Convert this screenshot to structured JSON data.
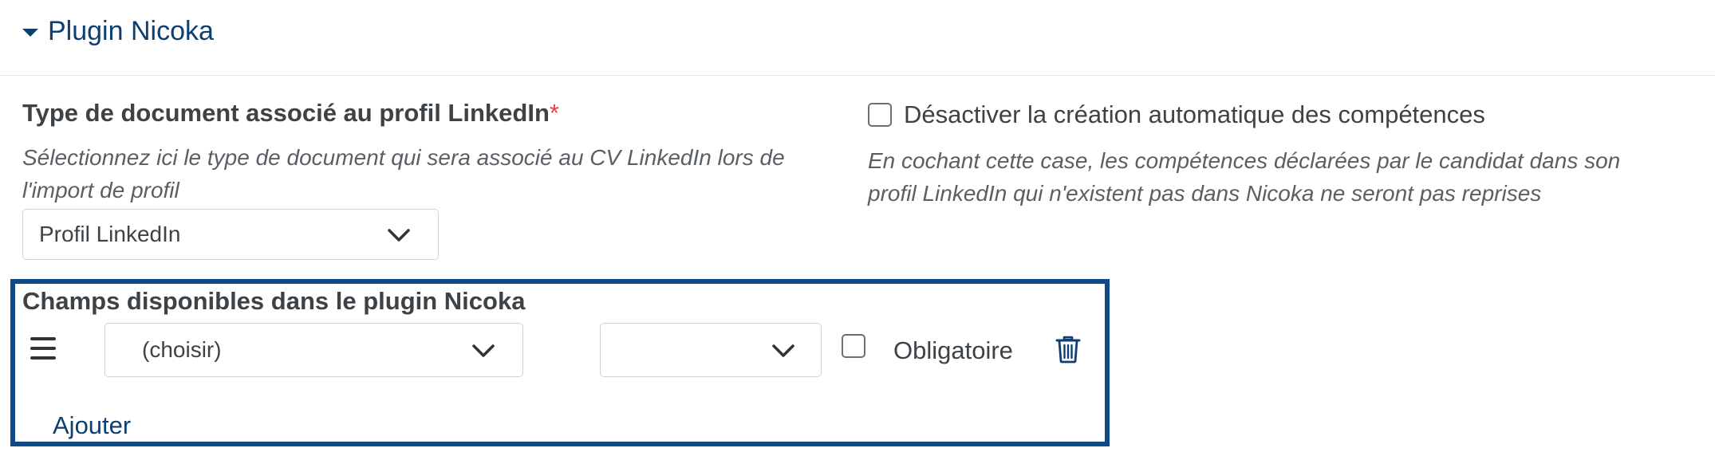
{
  "section": {
    "title": "Plugin Nicoka"
  },
  "document_type": {
    "label": "Type de document associé au profil LinkedIn",
    "required_mark": "*",
    "help": "Sélectionnez ici le type de document qui sera associé au CV LinkedIn lors de l'import de profil",
    "selected": "Profil LinkedIn"
  },
  "skills_option": {
    "label": "Désactiver la création automatique des compétences",
    "checked": false,
    "help": "En cochant cette case, les compétences déclarées par le candidat dans son profil LinkedIn qui n'existent pas dans Nicoka ne seront pas reprises"
  },
  "fields_panel": {
    "title": "Champs disponibles dans le plugin Nicoka",
    "row": {
      "field_select": "(choisir)",
      "type_select": "",
      "required_checked": false,
      "required_label": "Obligatoire"
    },
    "add_label": "Ajouter"
  },
  "colors": {
    "accent": "#0d3f73",
    "panel_border": "#0d4a86",
    "required": "#e8413b"
  },
  "icons": {
    "caret": "caret-down-icon",
    "chevron": "chevron-down-icon",
    "drag": "drag-handle-icon",
    "trash": "trash-icon"
  }
}
